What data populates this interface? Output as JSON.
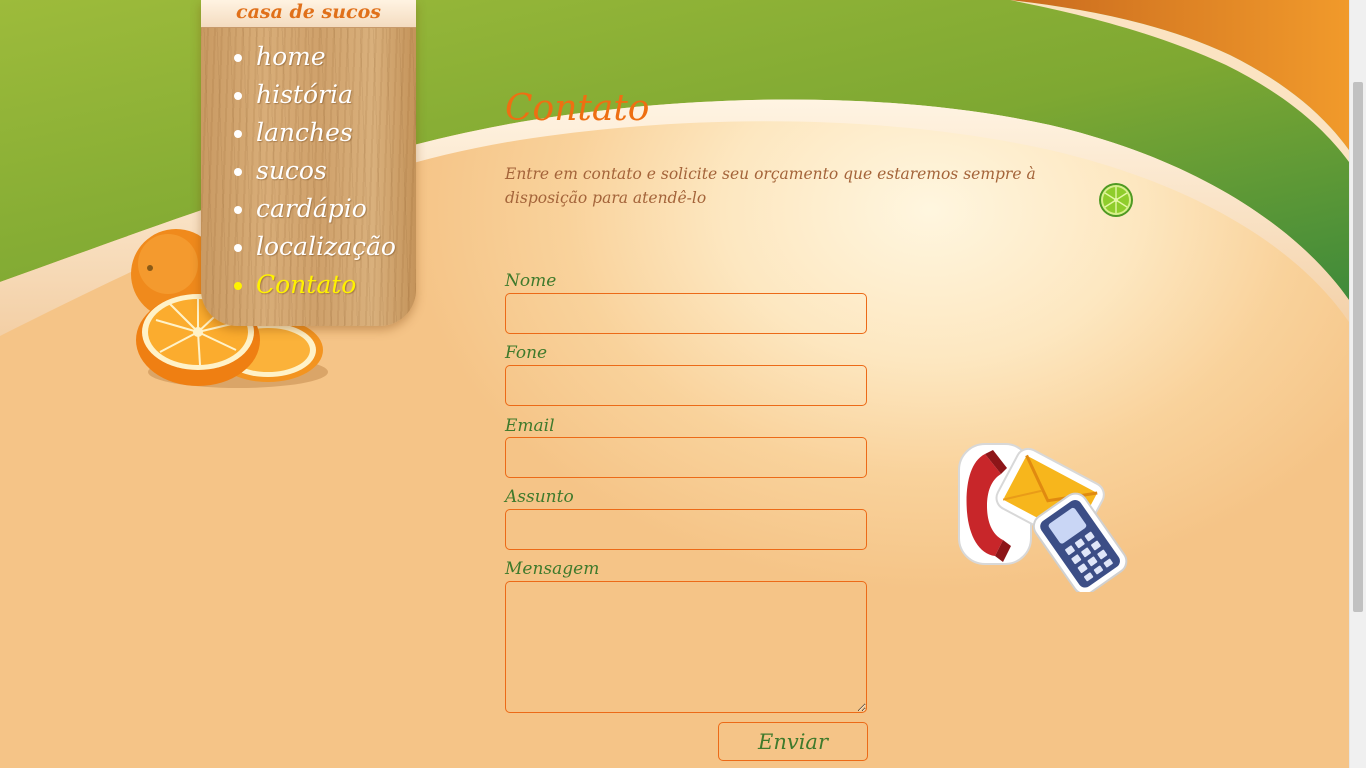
{
  "brand": {
    "name": "casa de sucos"
  },
  "nav": {
    "items": [
      {
        "label": "home",
        "active": false
      },
      {
        "label": "história",
        "active": false
      },
      {
        "label": "lanches",
        "active": false
      },
      {
        "label": "sucos",
        "active": false
      },
      {
        "label": "cardápio",
        "active": false
      },
      {
        "label": "localização",
        "active": false
      },
      {
        "label": "Contato",
        "active": true
      }
    ]
  },
  "content": {
    "title": "Contato",
    "intro": "Entre em contato e solicite seu orçamento que estaremos sempre à disposição para atendê-lo"
  },
  "form": {
    "fields": [
      {
        "label": "Nome",
        "value": ""
      },
      {
        "label": "Fone",
        "value": ""
      },
      {
        "label": "Email",
        "value": ""
      },
      {
        "label": "Assunto",
        "value": ""
      },
      {
        "label": "Mensagem",
        "value": ""
      }
    ],
    "submit_label": "Enviar"
  },
  "icons": {
    "lime": "lime-slice-icon",
    "contact": "contact-methods-icon",
    "oranges": "oranges-icon"
  },
  "colors": {
    "accent_orange": "#ee6f12",
    "label_green": "#3f7a2c",
    "intro_brown": "#a4643a",
    "active_nav": "#fff200",
    "field_border": "#ec6a17"
  }
}
